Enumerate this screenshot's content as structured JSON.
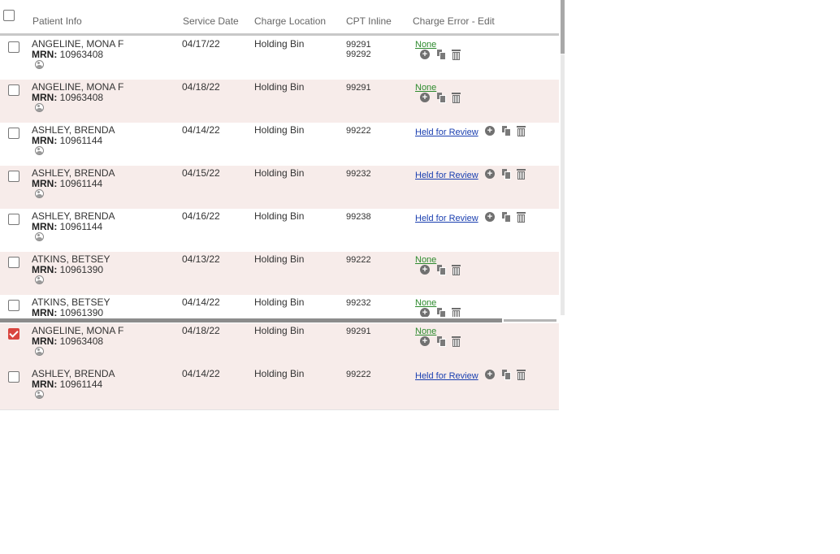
{
  "header": {
    "patient_info": "Patient Info",
    "service_date": "Service Date",
    "charge_location": "Charge Location",
    "cpt_inline": "CPT Inline",
    "charge_error": "Charge Error - Edit"
  },
  "rows": [
    {
      "name": "ANGELINE, MONA F",
      "mrn_label": "MRN:",
      "mrn": "10963408",
      "date": "04/17/22",
      "location": "Holding Bin",
      "cpt": [
        "99291",
        "99292"
      ],
      "error": "None",
      "checked": false
    },
    {
      "name": "ANGELINE, MONA F",
      "mrn_label": "MRN:",
      "mrn": "10963408",
      "date": "04/18/22",
      "location": "Holding Bin",
      "cpt": [
        "99291"
      ],
      "error": "None",
      "checked": false
    },
    {
      "name": "ASHLEY, BRENDA",
      "mrn_label": "MRN:",
      "mrn": "10961144",
      "date": "04/14/22",
      "location": "Holding Bin",
      "cpt": [
        "99222"
      ],
      "error": "Held for Review",
      "checked": false
    },
    {
      "name": "ASHLEY, BRENDA",
      "mrn_label": "MRN:",
      "mrn": "10961144",
      "date": "04/15/22",
      "location": "Holding Bin",
      "cpt": [
        "99232"
      ],
      "error": "Held for Review",
      "checked": false
    },
    {
      "name": "ASHLEY, BRENDA",
      "mrn_label": "MRN:",
      "mrn": "10961144",
      "date": "04/16/22",
      "location": "Holding Bin",
      "cpt": [
        "99238"
      ],
      "error": "Held for Review",
      "checked": false
    },
    {
      "name": "ATKINS, BETSEY",
      "mrn_label": "MRN:",
      "mrn": "10961390",
      "date": "04/13/22",
      "location": "Holding Bin",
      "cpt": [
        "99222"
      ],
      "error": "None",
      "checked": false
    },
    {
      "name": "ATKINS, BETSEY",
      "mrn_label": "MRN:",
      "mrn": "10961390",
      "date": "04/14/22",
      "location": "Holding Bin",
      "cpt": [
        "99232"
      ],
      "error": "None",
      "checked": false
    }
  ],
  "pinned_rows": [
    {
      "name": "ANGELINE, MONA F",
      "mrn_label": "MRN:",
      "mrn": "10963408",
      "date": "04/18/22",
      "location": "Holding Bin",
      "cpt": [
        "99291"
      ],
      "error": "None",
      "checked": true
    },
    {
      "name": "ASHLEY, BRENDA",
      "mrn_label": "MRN:",
      "mrn": "10961144",
      "date": "04/14/22",
      "location": "Holding Bin",
      "cpt": [
        "99222"
      ],
      "error": "Held for Review",
      "checked": false
    }
  ],
  "icons": {
    "add": "add-circle-icon",
    "copy": "copy-icon",
    "delete": "trash-icon",
    "avatar": "user-avatar-icon"
  },
  "colors": {
    "row_alt": "#f7ecea",
    "error_none": "#2d8a2d",
    "error_held": "#1a3fb0",
    "checkbox_checked": "#d9453f"
  }
}
